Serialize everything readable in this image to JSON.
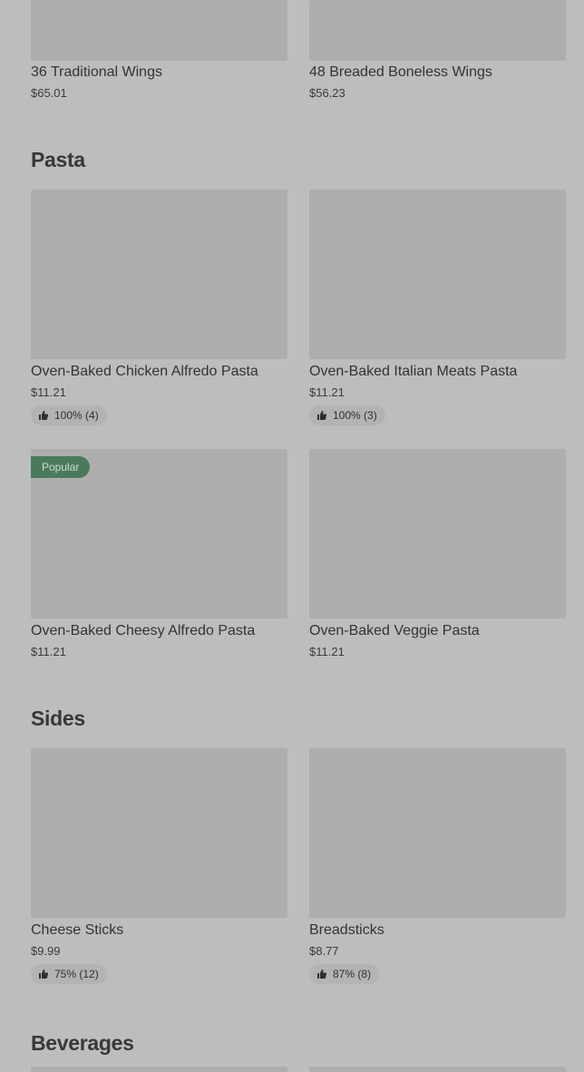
{
  "wings": {
    "items": [
      {
        "name": "36 Traditional Wings",
        "price": "$65.01"
      },
      {
        "name": "48 Breaded Boneless Wings",
        "price": "$56.23"
      }
    ]
  },
  "pasta": {
    "title": "Pasta",
    "items": [
      {
        "name": "Oven-Baked Chicken Alfredo Pasta",
        "price": "$11.21",
        "rating": "100% (4)"
      },
      {
        "name": "Oven-Baked Italian Meats Pasta",
        "price": "$11.21",
        "rating": "100% (3)"
      },
      {
        "name": "Oven-Baked Cheesy Alfredo Pasta",
        "price": "$11.21",
        "badge": "Popular"
      },
      {
        "name": "Oven-Baked Veggie Pasta",
        "price": "$11.21"
      }
    ]
  },
  "sides": {
    "title": "Sides",
    "items": [
      {
        "name": "Cheese Sticks",
        "price": "$9.99",
        "rating": "75% (12)"
      },
      {
        "name": "Breadsticks",
        "price": "$8.77",
        "rating": "87% (8)"
      }
    ]
  },
  "beverages": {
    "title": "Beverages"
  },
  "icons": {
    "rating": "thumbs-up-icon"
  },
  "colors": {
    "background": "#bdbdbd",
    "image_placeholder": "#aeaeae",
    "badge": "#4a7a5c"
  }
}
